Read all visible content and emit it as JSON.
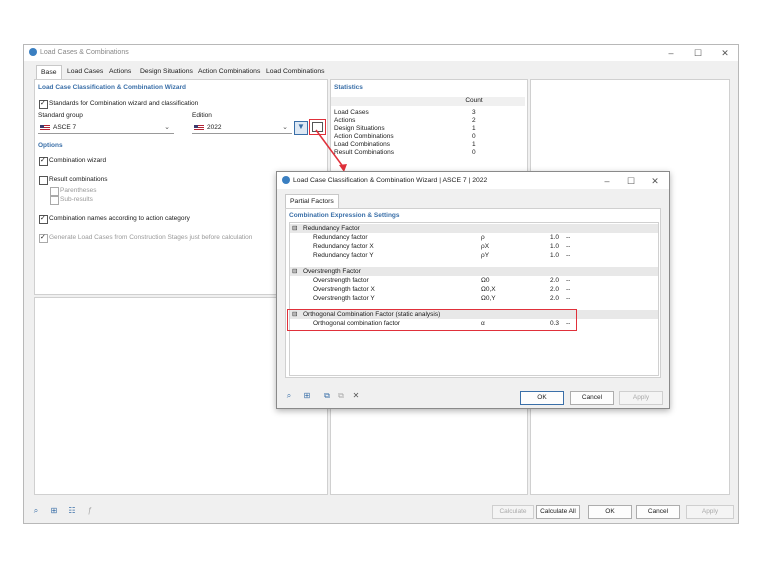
{
  "window": {
    "title": "Load Cases & Combinations"
  },
  "tabs": [
    "Base",
    "Load Cases",
    "Actions",
    "Design Situations",
    "Action Combinations",
    "Load Combinations"
  ],
  "left": {
    "section_title": "Load Case Classification & Combination Wizard",
    "standards_label": "Standards for Combination wizard and classification",
    "standard_group_label": "Standard group",
    "standard_group_value": "ASCE 7",
    "edition_label": "Edition",
    "edition_value": "2022",
    "options_title": "Options",
    "combination_wizard": "Combination wizard",
    "result_combinations": "Result combinations",
    "parentheses": "Parentheses",
    "sub_results": "Sub-results",
    "combination_names": "Combination names according to action category",
    "generate_label": "Generate Load Cases from Construction Stages just before calculation"
  },
  "statistics": {
    "title": "Statistics",
    "count_header": "Count",
    "rows": [
      {
        "name": "Load Cases",
        "count": "3"
      },
      {
        "name": "Actions",
        "count": "2"
      },
      {
        "name": "Design Situations",
        "count": "1"
      },
      {
        "name": "Action Combinations",
        "count": "0"
      },
      {
        "name": "Load Combinations",
        "count": "1"
      },
      {
        "name": "Result Combinations",
        "count": "0"
      }
    ]
  },
  "dialog": {
    "title": "Load Case Classification & Combination Wizard | ASCE 7 | 2022",
    "tab": "Partial Factors",
    "section": "Combination Expression & Settings",
    "groups": [
      {
        "name": "Redundancy Factor",
        "rows": [
          {
            "label": "Redundancy factor",
            "symbol": "ρ",
            "value": "1.0",
            "unit": "--"
          },
          {
            "label": "Redundancy factor X",
            "symbol": "ρX",
            "value": "1.0",
            "unit": "--"
          },
          {
            "label": "Redundancy factor Y",
            "symbol": "ρY",
            "value": "1.0",
            "unit": "--"
          }
        ]
      },
      {
        "name": "Overstrength Factor",
        "rows": [
          {
            "label": "Overstrength factor",
            "symbol": "Ω0",
            "value": "2.0",
            "unit": "--"
          },
          {
            "label": "Overstrength factor X",
            "symbol": "Ω0,X",
            "value": "2.0",
            "unit": "--"
          },
          {
            "label": "Overstrength factor Y",
            "symbol": "Ω0,Y",
            "value": "2.0",
            "unit": "--"
          }
        ]
      },
      {
        "name": "Orthogonal Combination Factor (static analysis)",
        "rows": [
          {
            "label": "Orthogonal combination factor",
            "symbol": "α",
            "value": "0.3",
            "unit": "--"
          }
        ]
      }
    ],
    "ok": "OK",
    "cancel": "Cancel",
    "apply": "Apply"
  },
  "footer": {
    "calculate": "Calculate",
    "calculate_all": "Calculate All",
    "ok": "OK",
    "cancel": "Cancel",
    "apply": "Apply"
  },
  "colors": {
    "accent": "#3a6fa8",
    "highlight": "#e0303a"
  }
}
